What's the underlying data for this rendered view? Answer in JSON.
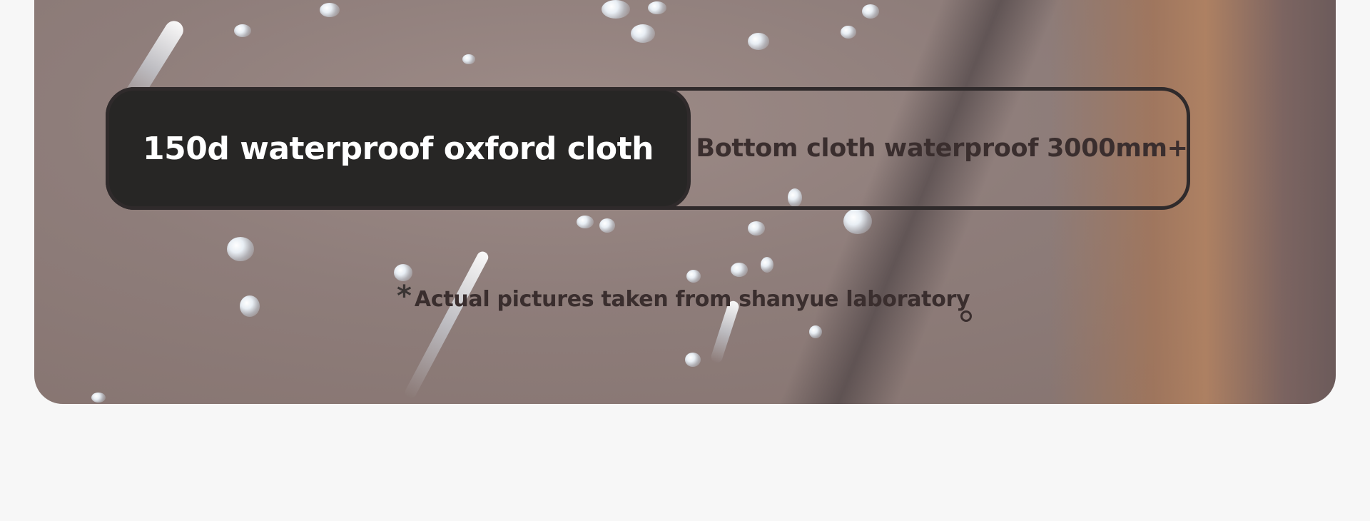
{
  "spec": {
    "primary_label": "150d waterproof oxford cloth",
    "secondary_label": "Bottom cloth waterproof 3000mm+"
  },
  "caption": {
    "symbol": "*",
    "text": "Actual pictures taken from shanyue laboratory"
  },
  "colors": {
    "page_background": "#f7f7f7",
    "primary_pill": "#272625",
    "outline": "#2f2a2b",
    "text_dark": "#3a2e2e",
    "text_light": "#ffffff"
  }
}
